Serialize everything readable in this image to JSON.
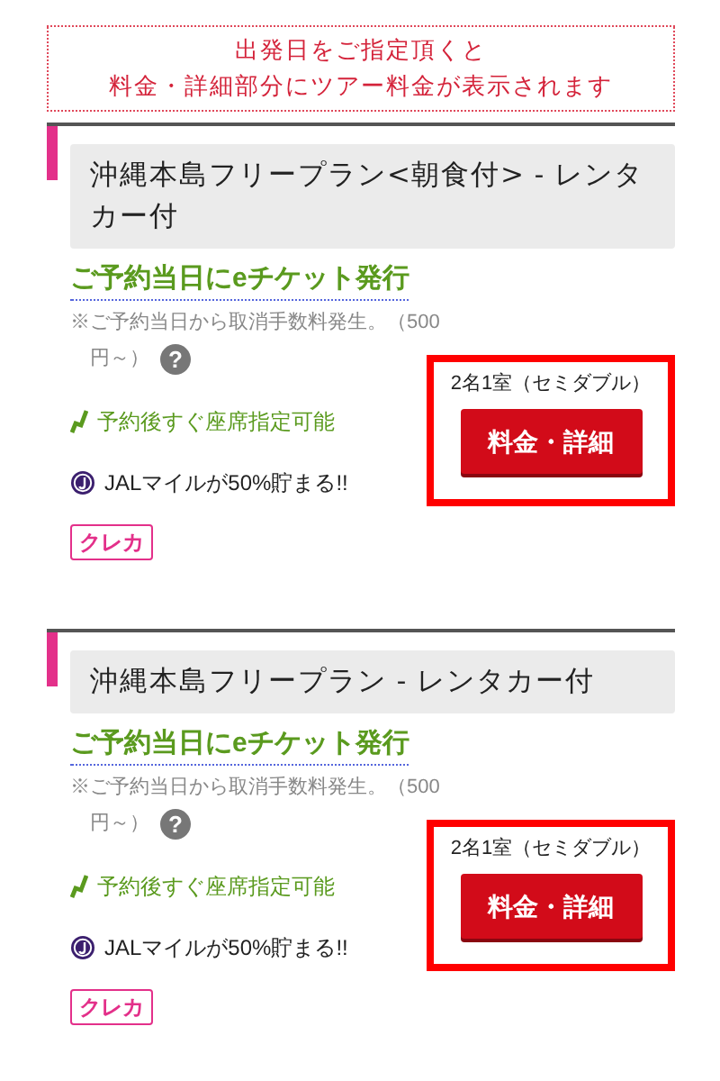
{
  "notice": {
    "lines": [
      "出発日をご指定頂くと",
      "料金・詳細部分にツアー料金が表示されます"
    ]
  },
  "plans": [
    {
      "title": "沖縄本島フリープラン<朝食付> - レンタカー付",
      "eticket": "ご予約当日にeチケット発行",
      "cancel_note": [
        "※ご予約当日から取消手数料発生。（500",
        "円～）"
      ],
      "help": "?",
      "features": [
        {
          "kind": "seat",
          "text": "予約後すぐ座席指定可能"
        },
        {
          "kind": "miles",
          "text": "JALマイルが50%貯まる!!"
        }
      ],
      "room": "2名1室（セミダブル）",
      "button": "料金・詳細",
      "highlighted": true,
      "payment_tag": "クレカ"
    },
    {
      "title": "沖縄本島フリープラン - レンタカー付",
      "eticket": "ご予約当日にeチケット発行",
      "cancel_note": [
        "※ご予約当日から取消手数料発生。（500",
        "円～）"
      ],
      "help": "?",
      "features": [
        {
          "kind": "seat",
          "text": "予約後すぐ座席指定可能"
        },
        {
          "kind": "miles",
          "text": "JALマイルが50%貯まる!!"
        }
      ],
      "room": "2名1室（セミダブル）",
      "button": "料金・詳細",
      "highlighted": true,
      "payment_tag": "クレカ"
    }
  ]
}
